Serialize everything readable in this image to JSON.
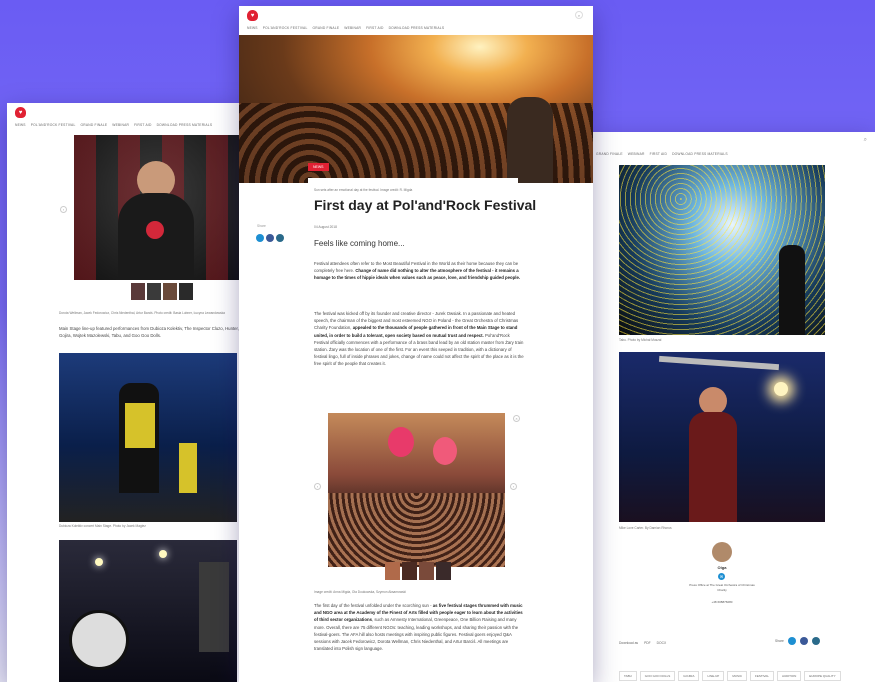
{
  "logo": {
    "glyph": "♥"
  },
  "nav": {
    "items": [
      "News",
      "Pol'and'Rock Festival",
      "Grand Finale",
      "Webinar",
      "First Aid",
      "Download Press Materials"
    ]
  },
  "right_nav": {
    "items": [
      "Grand Finale",
      "Webinar",
      "First Aid",
      "Download Press Materials"
    ]
  },
  "left": {
    "photo_caption": "Dorota Wellman, Jacek Fedorowicz, Chris Niedenthal, Artur Barciś. Photo credit: Basia Lubner, Łucyna Lewandowska",
    "text": "Main Stage line-up featured performances from Dubioza Kolektiv, The Inspector Cluzo, Hunter, Gojira, Wojtek Mazolewski, Tabu, and Goo Goo Dolls.",
    "photo2_caption": "Dubioza Kolektiv concert Main Stage. Photo by Jacek Magiez"
  },
  "center": {
    "hero_label": "News",
    "hero_caption": "Sun sets after an emotional day at the festival. Image credit: R. Migda",
    "title": "First day at Pol'and'Rock Festival",
    "date": "04 August 2018",
    "share_label": "Share",
    "subtitle": "Feels like coming home...",
    "gallery_caption": "Image credit: Anna Migda, Ola Doukowska, Szymon Aksamowski"
  },
  "right": {
    "photo1_caption": "Tabu. Photo by Michał Muszal",
    "photo2_caption": "Mike Love Carter. By Damian Rhorus",
    "person_name": "Olga",
    "person_role": "Press Office at The Great Orchestra of Christmas Charity",
    "person_phone": "+48 608876080",
    "download_label": "Download as",
    "download_pdf": "PDF",
    "download_docx": "DOCX",
    "share_label": "Share",
    "tags": [
      "Tabu",
      "Goo Goo Dolls",
      "Gojira",
      "Line-up",
      "Music",
      "Festival",
      "Audition",
      "Europe Quality"
    ]
  },
  "colors": {
    "accent": "#e02133",
    "background": "#6a5cf3",
    "share_blue": "#1d8fd2",
    "share_navy": "#3b5998",
    "share_teal": "#2a6a8a"
  }
}
